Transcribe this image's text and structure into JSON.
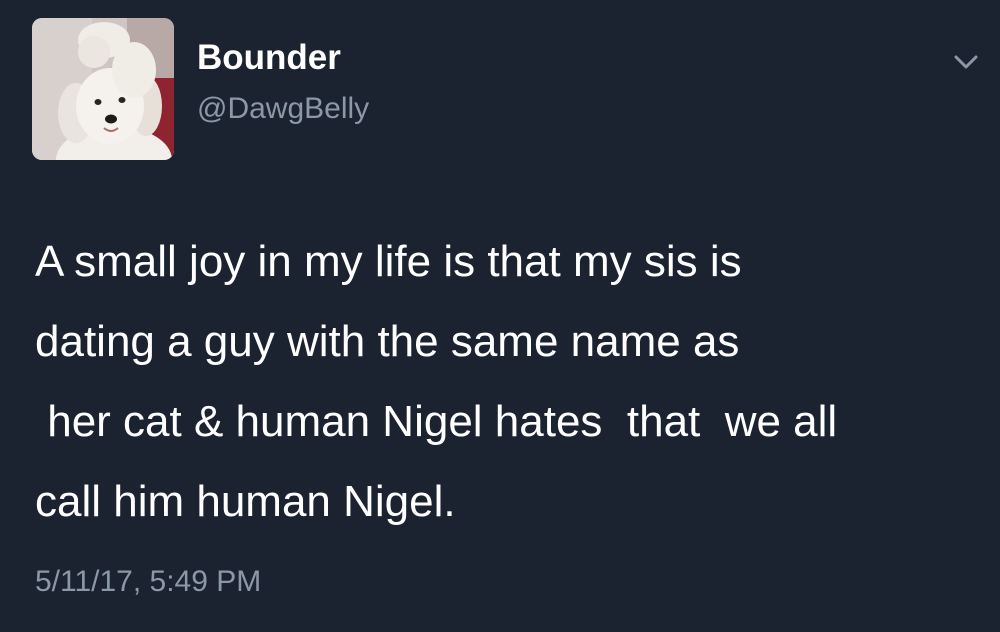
{
  "tweet": {
    "author": {
      "display_name": "Bounder",
      "handle": "@DawgBelly",
      "avatar_icon": "dog-avatar-icon"
    },
    "menu_icon": "chevron-down-icon",
    "text_lines": [
      "A small joy in my life is that my sis is",
      "dating a guy with the same name as",
      " her cat & human Nigel hates  that  we all",
      "call him human Nigel."
    ],
    "timestamp": "5/11/17, 5:49 PM"
  },
  "colors": {
    "background": "#1b2230",
    "text": "#ffffff",
    "secondary_text": "#8b98a8"
  }
}
